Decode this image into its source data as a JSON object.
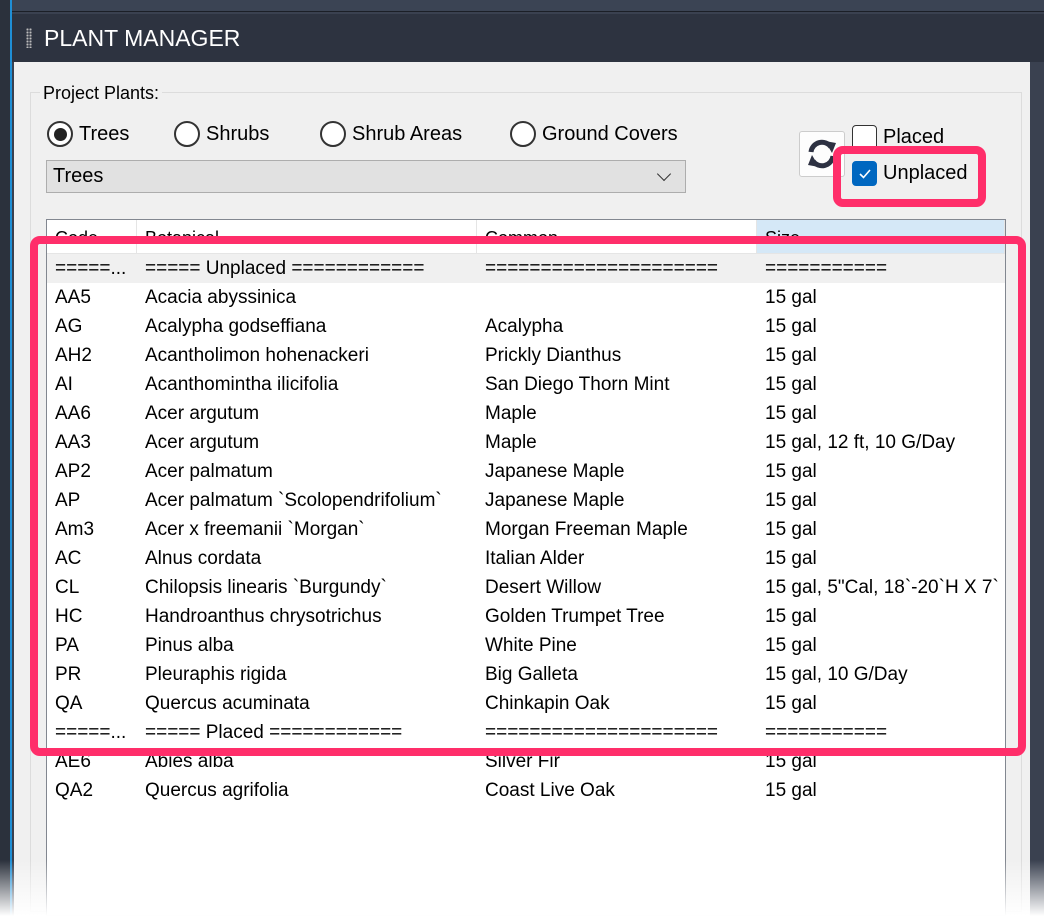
{
  "window": {
    "title": "PLANT MANAGER"
  },
  "group_label": "Project Plants:",
  "plant_types": [
    {
      "label": "Trees",
      "selected": true
    },
    {
      "label": "Shrubs",
      "selected": false
    },
    {
      "label": "Shrub Areas",
      "selected": false
    },
    {
      "label": "Ground Covers",
      "selected": false
    }
  ],
  "dropdown": {
    "value": "Trees"
  },
  "filters": {
    "placed": {
      "label": "Placed",
      "checked": false
    },
    "unplaced": {
      "label": "Unplaced",
      "checked": true
    }
  },
  "icons": {
    "refresh": "refresh-icon",
    "chevron": "chevron-down-icon"
  },
  "colors": {
    "highlight": "#ff2e6a",
    "checkbox": "#0067c0",
    "selected_header": "#d5e8f7"
  },
  "table": {
    "columns": [
      "Code",
      "Botanical",
      "Common",
      "Size"
    ],
    "rows": [
      {
        "sep": true,
        "cells": [
          "=====...",
          "===== Unplaced ============",
          "=====================",
          "==========="
        ]
      },
      {
        "cells": [
          "AA5",
          "Acacia abyssinica",
          "",
          "15 gal"
        ]
      },
      {
        "cells": [
          "AG",
          "Acalypha godseffiana",
          "Acalypha",
          "15 gal"
        ]
      },
      {
        "cells": [
          "AH2",
          "Acantholimon hohenackeri",
          "Prickly Dianthus",
          "15 gal"
        ]
      },
      {
        "cells": [
          "AI",
          "Acanthomintha ilicifolia",
          "San Diego Thorn Mint",
          "15 gal"
        ]
      },
      {
        "cells": [
          "AA6",
          "Acer argutum",
          "Maple",
          "15 gal"
        ]
      },
      {
        "cells": [
          "AA3",
          "Acer argutum",
          "Maple",
          "15 gal, 12 ft, 10 G/Day"
        ]
      },
      {
        "cells": [
          "AP2",
          "Acer palmatum",
          "Japanese Maple",
          "15 gal"
        ]
      },
      {
        "cells": [
          "AP",
          "Acer palmatum  `Scolopendrifolium`",
          "Japanese Maple",
          "15 gal"
        ]
      },
      {
        "cells": [
          "Am3",
          "Acer x freemanii `Morgan`",
          "Morgan Freeman Maple",
          "15 gal"
        ]
      },
      {
        "cells": [
          "AC",
          "Alnus cordata",
          "Italian Alder",
          "15 gal"
        ]
      },
      {
        "cells": [
          "CL",
          "Chilopsis linearis `Burgundy`",
          "Desert Willow",
          "15 gal, 5\"Cal, 18`-20`H X 7`"
        ]
      },
      {
        "cells": [
          "HC",
          "Handroanthus chrysotrichus",
          "Golden Trumpet Tree",
          "15 gal"
        ]
      },
      {
        "cells": [
          "PA",
          "Pinus alba",
          "White Pine",
          "15 gal"
        ]
      },
      {
        "cells": [
          "PR",
          "Pleuraphis rigida",
          "Big Galleta",
          "15 gal, 10 G/Day"
        ]
      },
      {
        "cells": [
          "QA",
          "Quercus acuminata",
          "Chinkapin Oak",
          "15 gal"
        ]
      },
      {
        "sep2": true,
        "cells": [
          "=====...",
          "===== Placed ============",
          "=====================",
          "==========="
        ]
      },
      {
        "cells": [
          "AE6",
          "Abies alba",
          "Silver Fir",
          "15 gal"
        ]
      },
      {
        "cells": [
          "QA2",
          "Quercus agrifolia",
          "Coast Live Oak",
          "15 gal"
        ]
      }
    ]
  }
}
